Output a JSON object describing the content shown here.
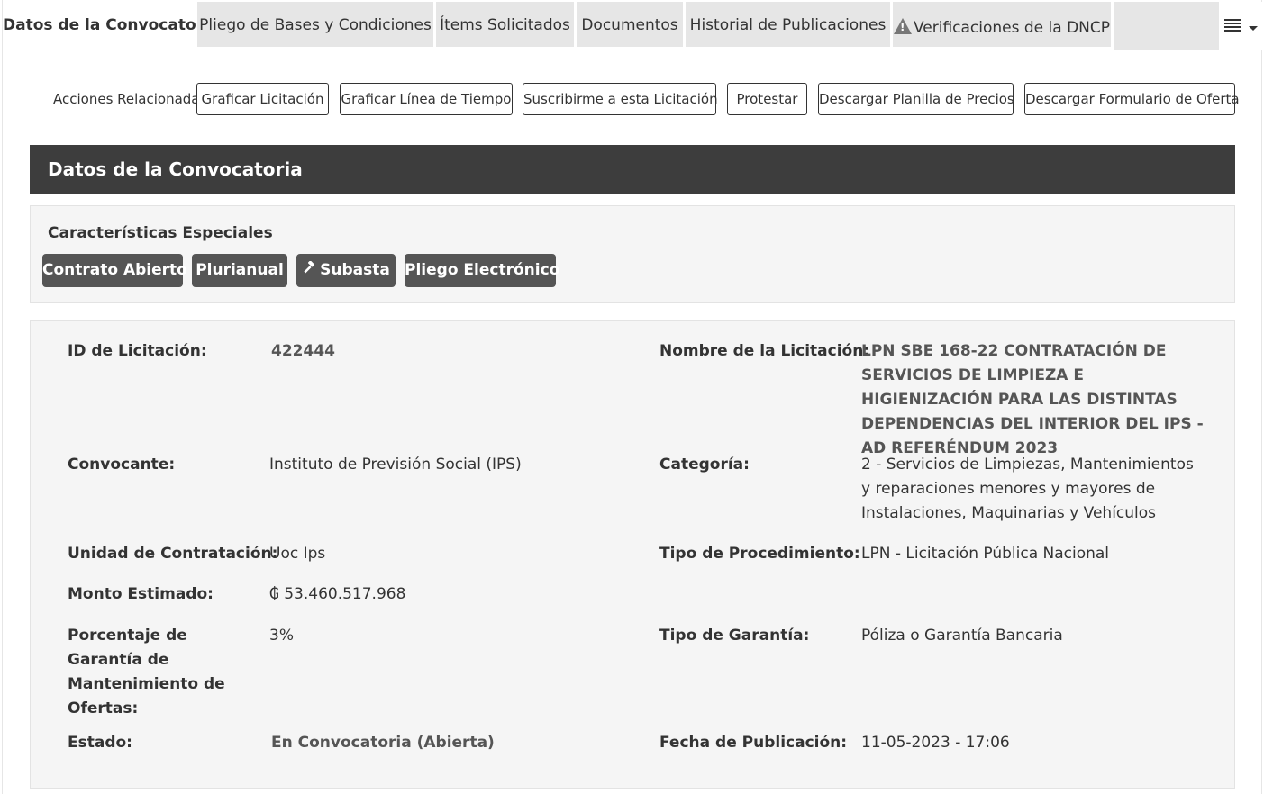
{
  "tabs": [
    {
      "label": "Datos de la Convocatoria",
      "active": true
    },
    {
      "label": "Pliego de Bases y Condiciones",
      "active": false
    },
    {
      "label": "Ítems Solicitados",
      "active": false
    },
    {
      "label": "Documentos",
      "active": false
    },
    {
      "label": "Historial de Publicaciones",
      "active": false
    },
    {
      "label": "Verificaciones de la DNCP",
      "active": false,
      "icon": "warning-icon"
    }
  ],
  "menu_icon": "list-menu-icon",
  "acciones": {
    "label": "Acciones Relacionadas:",
    "buttons": [
      "Graficar Licitación",
      "Graficar Línea de Tiempo",
      "Suscribirme a esta Licitación",
      "Protestar",
      "Descargar Planilla de Precios",
      "Descargar Formulario de Oferta"
    ]
  },
  "section": {
    "title": "Datos de la Convocatoria"
  },
  "caracteristicas": {
    "title": "Características Especiales",
    "badges": [
      {
        "label": "Contrato Abierto"
      },
      {
        "label": "Plurianual"
      },
      {
        "label": "Subasta",
        "icon": "gavel-icon"
      },
      {
        "label": "Pliego Electrónico"
      }
    ]
  },
  "details": {
    "id_label": "ID de Licitación:",
    "id_value": "422444",
    "nombre_label": "Nombre de la Licitación:",
    "nombre_value": "LPN SBE 168-22 CONTRATACIÓN DE SERVICIOS DE LIMPIEZA E HIGIENIZACIÓN PARA LAS DISTINTAS DEPENDENCIAS DEL INTERIOR DEL IPS - AD REFERÉNDUM 2023",
    "convocante_label": "Convocante:",
    "convocante_value": "Instituto de Previsión Social (IPS)",
    "categoria_label": "Categoría:",
    "categoria_value": "2 - Servicios de Limpiezas, Mantenimientos y reparaciones menores y mayores de Instalaciones, Maquinarias y Vehículos",
    "unidad_label": "Unidad de Contratación:",
    "unidad_value": "Uoc Ips",
    "tipo_proc_label": "Tipo de Procedimiento:",
    "tipo_proc_value": "LPN - Licitación Pública Nacional",
    "monto_label": "Monto Estimado:",
    "monto_value": "₲ 53.460.517.968",
    "porcentaje_label": "Porcentaje de Garantía de Mantenimiento de Ofertas:",
    "porcentaje_value": "3%",
    "tipo_garantia_label": "Tipo de Garantía:",
    "tipo_garantia_value": "Póliza o Garantía Bancaria",
    "estado_label": "Estado:",
    "estado_value": "En Convocatoria (Abierta)",
    "fecha_label": "Fecha de Publicación:",
    "fecha_value": "11-05-2023 - 17:06"
  }
}
